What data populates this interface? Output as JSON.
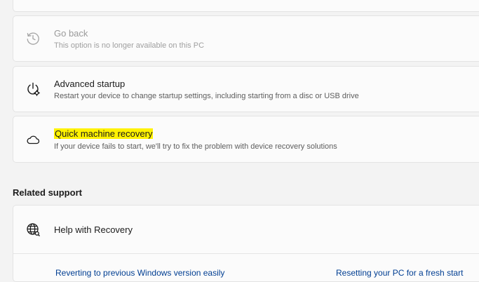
{
  "recovery_options": {
    "go_back": {
      "title": "Go back",
      "subtitle": "This option is no longer available on this PC",
      "icon": "history-icon"
    },
    "advanced_startup": {
      "title": "Advanced startup",
      "subtitle": "Restart your device to change startup settings, including starting from a disc or USB drive",
      "icon": "power-settings-icon"
    },
    "quick_machine_recovery": {
      "title": "Quick machine recovery",
      "subtitle": "If your device fails to start, we'll try to fix the problem with device recovery solutions",
      "icon": "cloud-icon",
      "highlight_color": "#fff200"
    }
  },
  "related_support": {
    "heading": "Related support",
    "help": {
      "title": "Help with Recovery",
      "icon": "globe-icon"
    },
    "links": [
      "Reverting to previous Windows version easily",
      "Resetting your PC for a fresh start"
    ]
  },
  "colors": {
    "page_bg": "#f3f3f3",
    "card_bg": "#fbfbfb",
    "link": "#003e92",
    "disabled_text": "#9a9a9a"
  }
}
